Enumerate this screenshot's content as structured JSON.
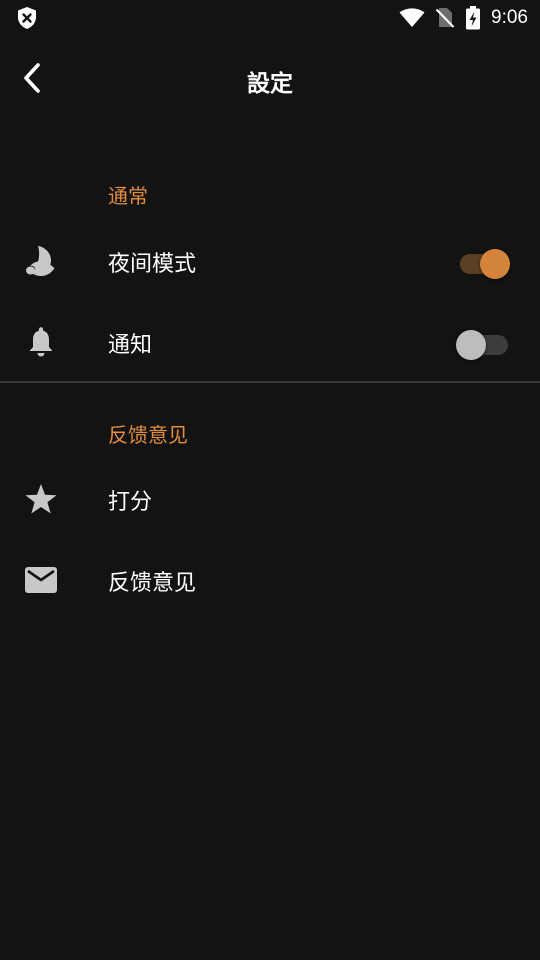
{
  "status_bar": {
    "time": "9:06",
    "icons": [
      "shield-x-icon",
      "wifi-icon",
      "no-sim-icon",
      "battery-charging-icon"
    ]
  },
  "app_bar": {
    "title": "設定",
    "back_icon": "chevron-left-icon"
  },
  "sections": {
    "general": {
      "header": "通常",
      "night_mode": {
        "label": "夜间模式",
        "icon": "moon-icon",
        "enabled": true
      },
      "notifications": {
        "label": "通知",
        "icon": "bell-icon",
        "enabled": false
      }
    },
    "feedback": {
      "header": "反馈意见",
      "rate": {
        "label": "打分",
        "icon": "star-icon"
      },
      "send_feedback": {
        "label": "反馈意见",
        "icon": "mail-icon"
      }
    }
  },
  "colors": {
    "background": "#131313",
    "accent": "#e28d3f",
    "toggle_on_thumb": "#d4843a",
    "toggle_on_track": "#5a3f22",
    "toggle_off_thumb": "#bdbdbd",
    "toggle_off_track": "#3d3d3d",
    "icon": "#c8c8c8"
  }
}
